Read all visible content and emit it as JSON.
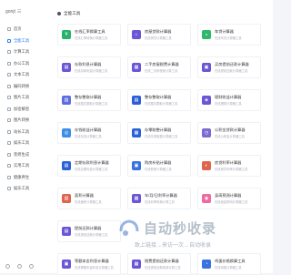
{
  "app": {
    "logo": "gonjt",
    "menu_glyph": "☰"
  },
  "sidebar": {
    "items": [
      {
        "label": "首页",
        "active": false
      },
      {
        "label": "全能工具",
        "active": true
      },
      {
        "label": "计算工具",
        "active": false
      },
      {
        "label": "办公工具",
        "active": false
      },
      {
        "label": "文本工具",
        "active": false
      },
      {
        "label": "编码转换",
        "active": false
      },
      {
        "label": "图片工具",
        "active": false
      },
      {
        "label": "加密解密",
        "active": false
      },
      {
        "label": "图片转换",
        "active": false
      },
      {
        "label": "站长工具",
        "active": false
      },
      {
        "label": "娱乐工具",
        "active": false
      },
      {
        "label": "装修生成",
        "active": false
      },
      {
        "label": "实用工具",
        "active": false
      },
      {
        "label": "健康养生",
        "active": false
      },
      {
        "label": "娱乐工具",
        "active": false
      }
    ]
  },
  "main": {
    "section_title": "全能工具",
    "cards": [
      {
        "title": "在线汇率换算工具",
        "desc": "在线汇率转换计算器工具",
        "color": "#29b36a",
        "icon": "¥"
      },
      {
        "title": "房屋贷款计算器",
        "desc": "在线房贷计算器工具",
        "color": "#6b56d6",
        "icon": "⌂"
      },
      {
        "title": "车贷计算器",
        "desc": "在线车贷计算器工具",
        "color": "#2fb86a",
        "icon": "◒"
      },
      {
        "title": "存款利息计算器",
        "desc": "在线存款利息计算器工具",
        "color": "#6b56d6",
        "icon": "▤"
      },
      {
        "title": "二手房屋税费计算器",
        "desc": "在线二手房税费计算工具",
        "color": "#6b56d6",
        "icon": "▦"
      },
      {
        "title": "买房提前还款计算器",
        "desc": "在线提前还款计算器工具",
        "color": "#6b56d6",
        "icon": "▣"
      },
      {
        "title": "整存整取计算器",
        "desc": "在线整存整取计算器工具",
        "color": "#5a6ee0",
        "icon": "▥"
      },
      {
        "title": "整存整取计算器",
        "desc": "在线整存整取计算器工具",
        "color": "#2b5fd8",
        "icon": "▤"
      },
      {
        "title": "理财收益计算器",
        "desc": "在线理财计算器工具",
        "color": "#6b56d6",
        "icon": "◈"
      },
      {
        "title": "存钱收益计算器",
        "desc": "在线存钱计算器工具",
        "color": "#3f8ee6",
        "icon": "◎"
      },
      {
        "title": "存零取整计算器",
        "desc": "在线存零取整计算器工具",
        "color": "#2b62d6",
        "icon": "▦"
      },
      {
        "title": "公积金贷款计算器",
        "desc": "在线公积金计算器工具",
        "color": "#7b6ad0",
        "icon": "◷"
      },
      {
        "title": "定期存款利息计算器",
        "desc": "在线定期利息计算器工具",
        "color": "#2b62d6",
        "icon": "▤"
      },
      {
        "title": "购房补贴计算器",
        "desc": "在线购房计算器工具",
        "color": "#3a72e0",
        "icon": "▣"
      },
      {
        "title": "房贷利率计算器",
        "desc": "在线房贷利率计算器工具",
        "color": "#e0654f",
        "icon": "◐"
      },
      {
        "title": "面积计算器",
        "desc": "在线面积计算器工具",
        "color": "#e0654f",
        "icon": "▥"
      },
      {
        "title": "年/月/日利率计算器",
        "desc": "在线利率转换计算工具",
        "color": "#6b56d6",
        "icon": "▦"
      },
      {
        "title": "身高预测计算器",
        "desc": "在线身高预测计算器工具",
        "color": "#ef6aa0",
        "icon": "◉"
      },
      {
        "title": "提前还款计算器",
        "desc": "在线提前还款计算器工具",
        "color": "#6b56d6",
        "icon": "▤"
      },
      {
        "title": "",
        "desc": "",
        "color": "",
        "icon": ""
      },
      {
        "title": "",
        "desc": "",
        "color": "",
        "icon": ""
      },
      {
        "title": "等额本金利息计算器",
        "desc": "在线等额本金利息计算器工具",
        "color": "#6b56d6",
        "icon": "▣"
      },
      {
        "title": "税费提前还款计算器",
        "desc": "在线提前还款税费计算工具",
        "color": "#6b56d6",
        "icon": "▦"
      },
      {
        "title": "鸡蛋价格换算工具",
        "desc": "在线鸡蛋计算器工具",
        "color": "#3a72e0",
        "icon": "◔"
      }
    ]
  },
  "watermark": {
    "title": "自动秒收录",
    "subtitle": "致上链接→来访一次→自动收录"
  }
}
